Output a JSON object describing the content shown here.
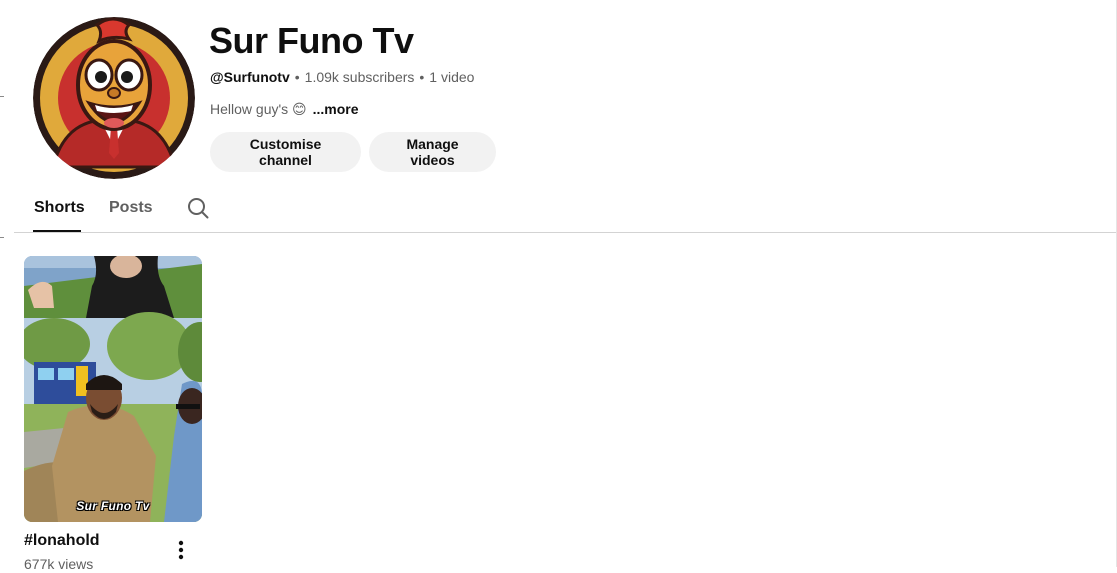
{
  "channel": {
    "name": "Sur Funo Tv",
    "handle": "@Surfunotv",
    "subscribers": "1.09k subscribers",
    "video_count": "1 video",
    "separator": "•",
    "description": "Hellow guy's 😊",
    "more_label": "...more"
  },
  "actions": {
    "customise_label": "Customise channel",
    "manage_label": "Manage videos"
  },
  "tabs": [
    {
      "label": "Shorts",
      "selected": true
    },
    {
      "label": "Posts",
      "selected": false
    }
  ],
  "icons": {
    "search": "search-icon",
    "more": "more-vert-icon"
  },
  "shorts": [
    {
      "title": "#lonahold",
      "views": "677k views",
      "watermark": "Sur Funo Tv"
    }
  ],
  "colors": {
    "text_primary": "#0f0f0f",
    "text_secondary": "#606060",
    "button_bg": "#f2f2f2",
    "avatar_gold": "#e0a93b",
    "avatar_red": "#c8302e"
  }
}
